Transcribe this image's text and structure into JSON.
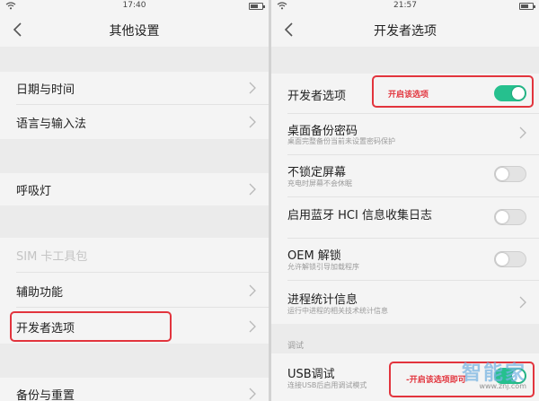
{
  "left": {
    "status": {
      "time": "17:40"
    },
    "title": "其他设置",
    "items": [
      {
        "label": "日期与时间"
      },
      {
        "label": "语言与输入法"
      },
      {
        "label": "呼吸灯"
      },
      {
        "label": "SIM 卡工具包"
      },
      {
        "label": "辅助功能"
      },
      {
        "label": "开发者选项"
      },
      {
        "label": "备份与重置"
      }
    ]
  },
  "right": {
    "status": {
      "time": "21:57"
    },
    "title": "开发者选项",
    "items": [
      {
        "label": "开发者选项",
        "on": true
      },
      {
        "label": "桌面备份密码",
        "sub": "桌面完整备份当前未设置密码保护"
      },
      {
        "label": "不锁定屏幕",
        "sub": "充电时屏幕不会休眠",
        "on": false
      },
      {
        "label": "启用蓝牙 HCI 信息收集日志",
        "on": false
      },
      {
        "label": "OEM 解锁",
        "sub": "允许解锁引导加载程序",
        "on": false
      },
      {
        "label": "进程统计信息",
        "sub": "运行中进程的相关技术统计信息"
      },
      {
        "label": "USB调试",
        "sub": "连接USB后启用调试模式",
        "on": true
      }
    ],
    "section_debug": "调试",
    "callout_1": "开启该选项",
    "callout_2": "-开启该选项即可"
  },
  "watermark": {
    "brand": "智能家",
    "url": "www.znj.com"
  },
  "colors": {
    "accent": "#26c08e",
    "annotation": "#e2343d"
  }
}
